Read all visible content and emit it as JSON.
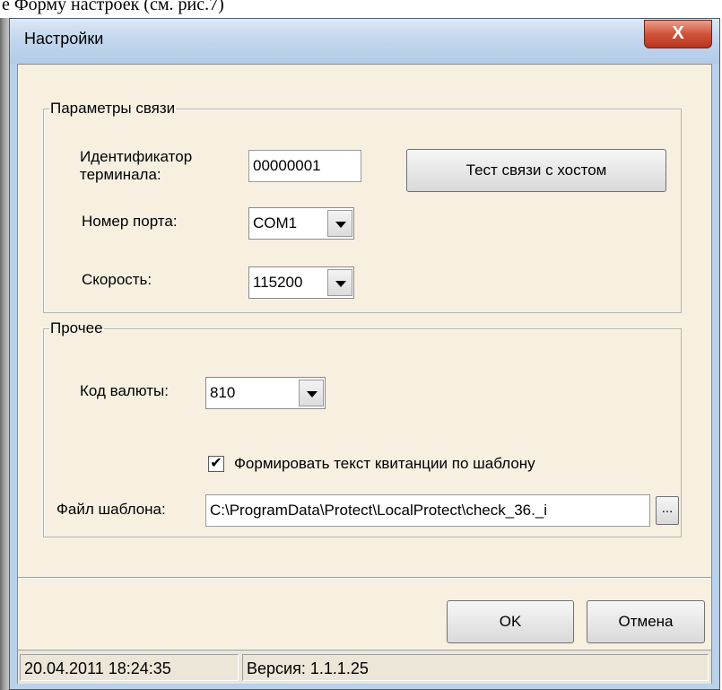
{
  "document": {
    "caption": "е Форму настроек (см. рис.7)"
  },
  "window": {
    "title": "Настройки",
    "close_glyph": "X"
  },
  "connection": {
    "legend": "Параметры связи",
    "terminal_id_label": "Идентификатор терминала:",
    "terminal_id_value": "00000001",
    "test_button_label": "Тест связи с хостом",
    "port_label": "Номер порта:",
    "port_value": "COM1",
    "speed_label": "Скорость:",
    "speed_value": "115200"
  },
  "other": {
    "legend": "Прочее",
    "currency_label": "Код валюты:",
    "currency_value": "810",
    "template_checkbox_label": "Формировать текст квитанции по шаблону",
    "template_checkbox_checked": true,
    "template_checkbox_glyph": "✔",
    "template_file_label": "Файл шаблона:",
    "template_file_value": "C:\\ProgramData\\Protect\\LocalProtect\\check_36._i",
    "browse_button_label": "..."
  },
  "actions": {
    "ok_label": "OK",
    "cancel_label": "Отмена"
  },
  "status": {
    "datetime": "20.04.2011 18:24:35",
    "version": "Версия: 1.1.1.25"
  }
}
